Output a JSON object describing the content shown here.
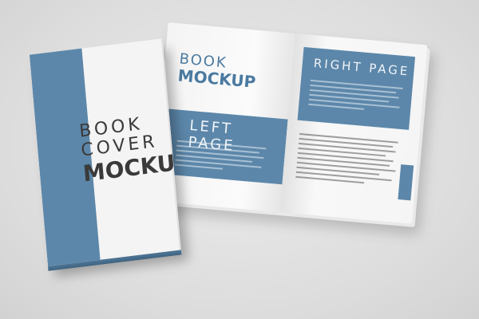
{
  "closed_book": {
    "title_line1": "BOOK",
    "title_line2": "COVER",
    "title_line3": "MOCKUP"
  },
  "open_book": {
    "left_page": {
      "title_line1": "BOOK",
      "title_line2": "MOCKUP",
      "band_label": "LEFT PAGE"
    },
    "right_page": {
      "band_label": "RIGHT PAGE"
    }
  },
  "colors": {
    "accent_blue": "#5c87aa",
    "background": "#dcdcdc",
    "paper": "#f5f5f5",
    "cover_text": "#3a3a3a"
  }
}
